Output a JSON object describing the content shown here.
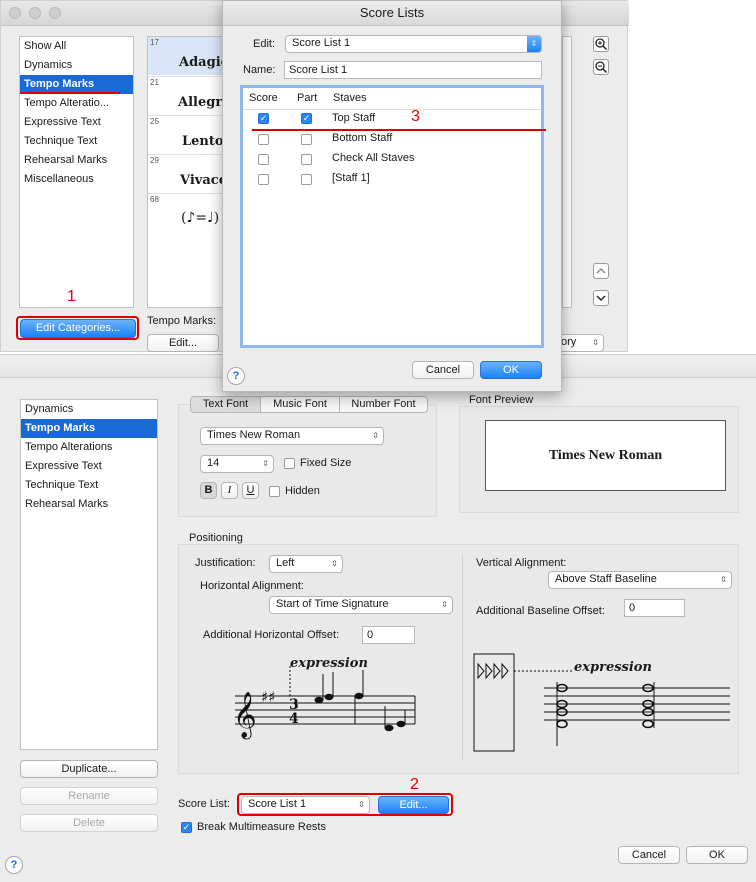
{
  "back_window": {
    "categories": [
      "Show All",
      "Dynamics",
      "Tempo Marks",
      "Tempo Alteratio...",
      "Expressive Text",
      "Technique Text",
      "Rehearsal Marks",
      "Miscellaneous"
    ],
    "selected_index": 2,
    "edit_categories": "Edit Categories...",
    "tempo_marks_label": "Tempo Marks:",
    "edit_button": "Edit...",
    "category_popup_text": "ory",
    "palette": [
      {
        "num": "17",
        "label": "Adagio"
      },
      {
        "num": "21",
        "label": "Allegro"
      },
      {
        "num": "25",
        "label": "Lento"
      },
      {
        "num": "29",
        "label": "Vivace"
      },
      {
        "num": "68",
        "label": "(♪=♩)"
      }
    ]
  },
  "score_lists_dialog": {
    "title": "Score Lists",
    "edit_label": "Edit:",
    "edit_value": "Score List 1",
    "name_label": "Name:",
    "name_value": "Score List 1",
    "columns": [
      "Score",
      "Part",
      "Staves"
    ],
    "rows": [
      {
        "score": true,
        "part": true,
        "staff": "Top Staff"
      },
      {
        "score": false,
        "part": false,
        "staff": "Bottom Staff"
      },
      {
        "score": false,
        "part": false,
        "staff": "Check All Staves"
      },
      {
        "score": false,
        "part": false,
        "staff": "[Staff 1]"
      }
    ],
    "cancel": "Cancel",
    "ok": "OK",
    "help": "?"
  },
  "main_dialog": {
    "categories": [
      "Dynamics",
      "Tempo Marks",
      "Tempo Alterations",
      "Expressive Text",
      "Technique Text",
      "Rehearsal Marks"
    ],
    "selected_index": 1,
    "duplicate": "Duplicate...",
    "rename": "Rename",
    "delete": "Delete",
    "font_tabs": [
      "Text Font",
      "Music Font",
      "Number Font"
    ],
    "font_name": "Times New Roman",
    "font_size": "14",
    "fixed_size": "Fixed Size",
    "bold": "B",
    "italic": "I",
    "underline": "U",
    "hidden": "Hidden",
    "font_preview_label": "Font Preview",
    "font_preview_text": "Times New Roman",
    "positioning_label": "Positioning",
    "justification_label": "Justification:",
    "justification_value": "Left",
    "horizontal_alignment_label": "Horizontal Alignment:",
    "horizontal_alignment_value": "Start of Time Signature",
    "additional_horizontal_offset_label": "Additional Horizontal Offset:",
    "additional_horizontal_offset_value": "0",
    "vertical_alignment_label": "Vertical Alignment:",
    "vertical_alignment_value": "Above Staff Baseline",
    "additional_baseline_offset_label": "Additional Baseline Offset:",
    "additional_baseline_offset_value": "0",
    "expression_sample": "expression",
    "score_list_label": "Score List:",
    "score_list_value": "Score List 1",
    "edit_button": "Edit...",
    "break_multimeasure": "Break Multimeasure Rests",
    "cancel": "Cancel",
    "ok": "OK",
    "help": "?"
  },
  "annotations": {
    "one": "1",
    "two": "2",
    "three": "3"
  },
  "colors": {
    "accent": "#1a82fb",
    "selection": "#1a6ad6",
    "annotation": "#e00000"
  }
}
